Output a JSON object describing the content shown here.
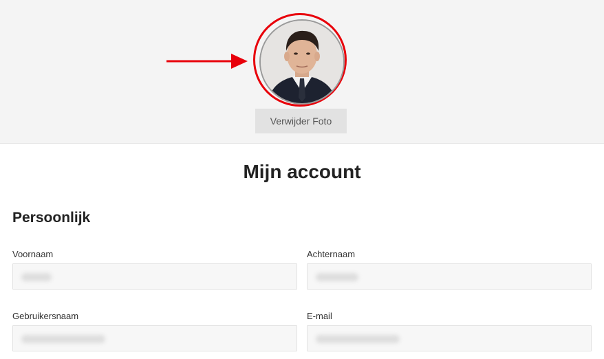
{
  "profile": {
    "remove_photo_label": "Verwijder Foto",
    "avatar_alt": "profile photo"
  },
  "page": {
    "title": "Mijn account"
  },
  "section": {
    "title": "Persoonlijk"
  },
  "fields": {
    "first_name": {
      "label": "Voornaam",
      "value": ""
    },
    "last_name": {
      "label": "Achternaam",
      "value": ""
    },
    "username": {
      "label": "Gebruikersnaam",
      "value": ""
    },
    "email": {
      "label": "E-mail",
      "value": ""
    }
  },
  "colors": {
    "highlight": "#e8000a",
    "band": "#f4f4f4",
    "button": "#e2e2e2"
  }
}
